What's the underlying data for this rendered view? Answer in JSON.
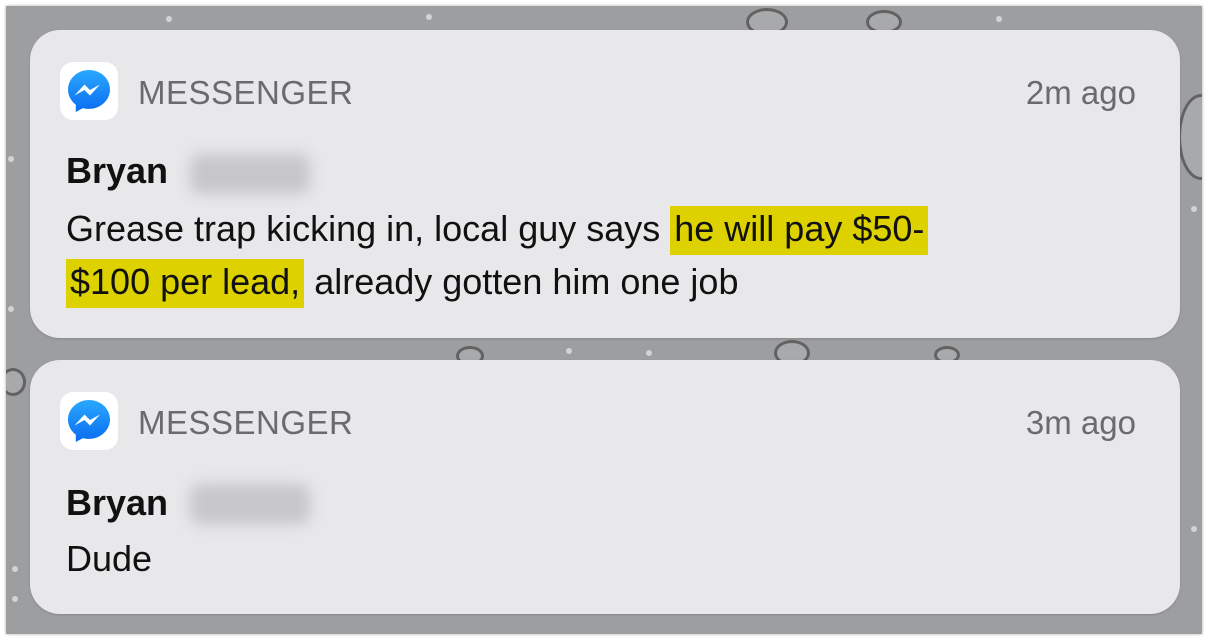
{
  "notifications": [
    {
      "app_name": "MESSENGER",
      "time": "2m ago",
      "sender": "Bryan",
      "message_before": "Grease trap kicking in, local guy says ",
      "message_highlight_1": "he will pay $50-",
      "message_highlight_2": "$100 per lead,",
      "message_after": " already gotten him one job"
    },
    {
      "app_name": "MESSENGER",
      "time": "3m ago",
      "sender": "Bryan",
      "message": "Dude"
    }
  ],
  "icons": {
    "app_icon": "messenger-icon"
  },
  "colors": {
    "highlight": "#ddd200",
    "card_background": "#e8e8ea",
    "messenger_blue": "#1a8cff"
  }
}
